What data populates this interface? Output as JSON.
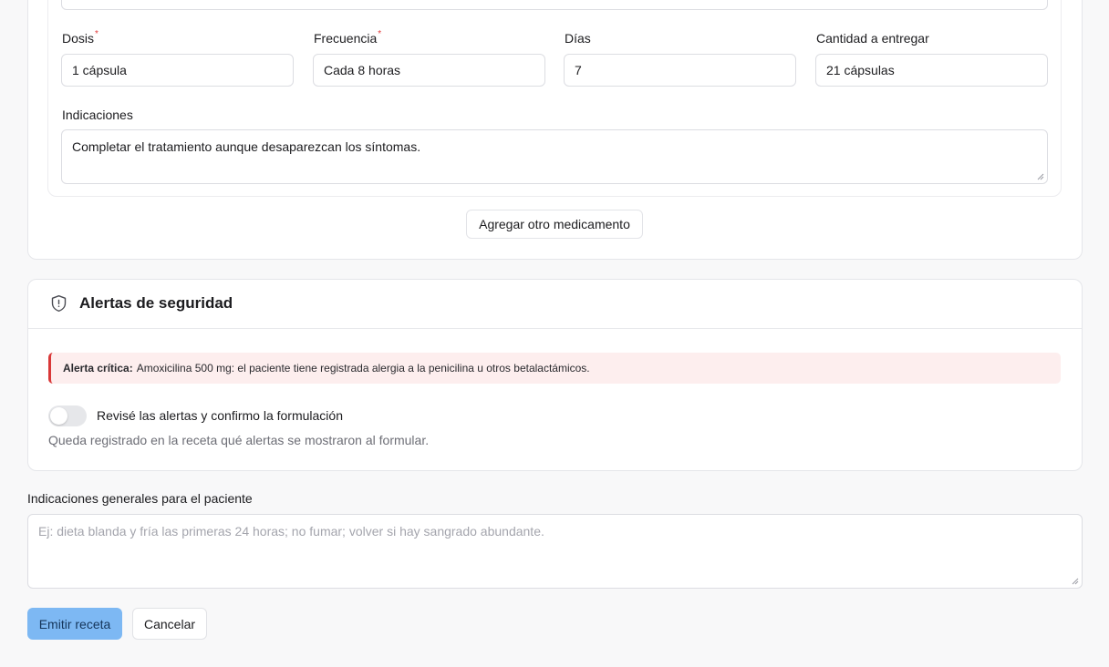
{
  "medication": {
    "dose_label": "Dosis",
    "dose_value": "1 cápsula",
    "frequency_label": "Frecuencia",
    "frequency_value": "Cada 8 horas",
    "days_label": "Días",
    "days_value": "7",
    "quantity_label": "Cantidad a entregar",
    "quantity_value": "21 cápsulas",
    "required_mark": "*",
    "indications_label": "Indicaciones",
    "indications_value": "Completar el tratamiento aunque desaparezcan los síntomas.",
    "add_button": "Agregar otro medicamento"
  },
  "alerts": {
    "title": "Alertas de seguridad",
    "critical_prefix": "Alerta crítica:",
    "critical_text": "Amoxicilina 500 mg: el paciente tiene registrada alergia a la penicilina u otros betalactámicos.",
    "toggle_label": "Revisé las alertas y confirmo la formulación",
    "toggle_on": false,
    "note": "Queda registrado en la receta qué alertas se mostraron al formular."
  },
  "general": {
    "label": "Indicaciones generales para el paciente",
    "placeholder": "Ej: dieta blanda y fría las primeras 24 horas; no fumar; volver si hay sangrado abundante."
  },
  "actions": {
    "emit": "Emitir receta",
    "cancel": "Cancelar"
  },
  "colors": {
    "primary_disabled": "#7db8f3",
    "alert_bg": "#fdeeee",
    "alert_border": "#d93838"
  }
}
